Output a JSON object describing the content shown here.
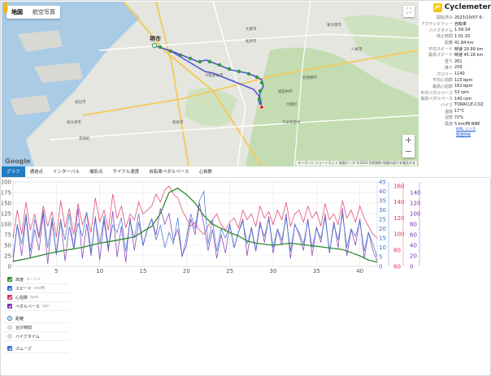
{
  "map": {
    "type_map": "地図",
    "type_satellite": "航空写真",
    "city_label": "堺市",
    "logo": "Google",
    "credits": "キーボード ショートカット  地図データ ©2023  利用規約  地図の誤りを報告する",
    "labels": [
      "大阪狭山市",
      "和泉市",
      "河南町",
      "千早赤阪村",
      "富田林市",
      "羽曳野市",
      "松原市",
      "大東市",
      "八尾市",
      "東大阪市",
      "泉大津市",
      "高石市",
      "忠岡町"
    ]
  },
  "info": {
    "title": "Cyclemeter",
    "rows": [
      {
        "k": "開始済み",
        "v": "2023/10/07 6:"
      },
      {
        "k": "アクティビティー",
        "v": "自転車"
      },
      {
        "k": "バイクタイム",
        "v": "1:59:34"
      },
      {
        "k": "停止時間",
        "v": "1:01:20"
      },
      {
        "k": "距離",
        "v": "41.84 km"
      },
      {
        "k": "平均スピード",
        "v": "時速 20.99 km"
      },
      {
        "k": "最高スピード",
        "v": "時速 45.18 km"
      },
      {
        "k": "登り",
        "v": "261"
      },
      {
        "k": "降り",
        "v": "256"
      },
      {
        "k": "カロリー",
        "v": "1140"
      },
      {
        "k": "平均心拍数",
        "v": "115 bpm"
      },
      {
        "k": "最高心拍数",
        "v": "162 bpm"
      },
      {
        "k": "平均ペダルペース",
        "v": "53 rpm"
      },
      {
        "k": "最高ペダルペース",
        "v": "140 rpm"
      },
      {
        "k": "バイク",
        "v": "TORACLE-COZ"
      },
      {
        "k": "温度",
        "v": "17°C"
      },
      {
        "k": "湿度",
        "v": "72%"
      },
      {
        "k": "風速",
        "v": "5 km/時 NNE"
      }
    ],
    "link1": "KML リンク",
    "link2": "関連情報"
  },
  "tabs": [
    "グラフ",
    "通過点",
    "インターバル",
    "撮影点",
    "サイクル速度",
    "自転車ペダルペース",
    "心拍数"
  ],
  "controls": {
    "series": [
      {
        "label": "高度",
        "unit": "メートル",
        "color": "#2e8b2e"
      },
      {
        "label": "スピード",
        "unit": "km/時",
        "color": "#2f6fd0"
      },
      {
        "label": "心拍数",
        "unit": "bpm",
        "color": "#e03060"
      },
      {
        "label": "ペダルペース",
        "unit": "rpm",
        "color": "#7b2fb0"
      }
    ],
    "xmodes": [
      "距離",
      "合計時間",
      "バイクタイム"
    ],
    "smooth": "スムーズ"
  },
  "chart_data": {
    "type": "line",
    "xlim": [
      0,
      42
    ],
    "x_ticks": [
      5,
      10,
      15,
      20,
      25,
      30,
      35,
      40
    ],
    "left_axis": {
      "ticks": [
        0,
        25,
        50,
        75,
        100,
        125,
        150,
        175,
        200
      ],
      "ylim": [
        0,
        200
      ]
    },
    "axis2": {
      "ticks": [
        0,
        5,
        10,
        15,
        20,
        25,
        30,
        35,
        40,
        45
      ],
      "ylim": [
        0,
        45
      ],
      "color": "#2f6fd0"
    },
    "axis3": {
      "ticks": [
        60,
        80,
        100,
        120,
        140,
        160
      ],
      "ylim": [
        60,
        165
      ],
      "color": "#e03060"
    },
    "axis4": {
      "ticks": [
        0,
        20,
        40,
        60,
        80,
        100,
        120,
        140
      ],
      "ylim": [
        0,
        160
      ],
      "color": "#7b2fb0"
    },
    "series": [
      {
        "name": "高度",
        "axis": "left",
        "color": "#2e8b2e",
        "x": [
          0,
          2,
          4,
          6,
          8,
          10,
          12,
          14,
          16,
          17,
          18,
          19,
          20,
          21,
          22,
          23,
          24,
          25,
          26,
          27,
          28,
          30,
          32,
          34,
          36,
          38,
          40,
          41,
          42
        ],
        "y": [
          12,
          20,
          30,
          38,
          45,
          55,
          62,
          70,
          95,
          125,
          175,
          185,
          170,
          150,
          120,
          100,
          90,
          80,
          72,
          60,
          55,
          50,
          55,
          50,
          45,
          40,
          25,
          15,
          10
        ]
      },
      {
        "name": "スピード",
        "axis": "axis2",
        "color": "#2f6fd0",
        "x": [
          0,
          0.5,
          1,
          1.5,
          2,
          2.5,
          3,
          3.5,
          4,
          4.5,
          5,
          5.5,
          6,
          6.5,
          7,
          7.5,
          8,
          8.5,
          9,
          9.5,
          10,
          10.5,
          11,
          11.5,
          12,
          12.5,
          13,
          13.5,
          14,
          14.5,
          15,
          15.5,
          16,
          16.5,
          17,
          17.5,
          18,
          18.5,
          19,
          19.5,
          20,
          20.5,
          21,
          21.5,
          22,
          22.5,
          23,
          23.5,
          24,
          24.5,
          25,
          25.5,
          26,
          26.5,
          27,
          27.5,
          28,
          28.5,
          29,
          29.5,
          30,
          30.5,
          31,
          31.5,
          32,
          32.5,
          33,
          33.5,
          34,
          34.5,
          35,
          35.5,
          36,
          36.5,
          37,
          37.5,
          38,
          38.5,
          39,
          39.5,
          40,
          40.5,
          41,
          41.5,
          42
        ],
        "y": [
          5,
          22,
          12,
          28,
          8,
          25,
          15,
          30,
          10,
          26,
          6,
          24,
          14,
          28,
          9,
          23,
          16,
          29,
          7,
          25,
          12,
          27,
          10,
          22,
          18,
          26,
          8,
          24,
          15,
          28,
          11,
          20,
          25,
          14,
          22,
          10,
          18,
          12,
          26,
          5,
          15,
          28,
          20,
          35,
          40,
          12,
          25,
          8,
          20,
          15,
          22,
          10,
          18,
          24,
          12,
          20,
          8,
          22,
          16,
          25,
          10,
          20,
          14,
          26,
          8,
          22,
          18,
          12,
          24,
          10,
          20,
          15,
          26,
          8,
          22,
          14,
          28,
          10,
          20,
          16,
          24,
          8,
          18,
          12,
          5
        ]
      },
      {
        "name": "心拍数",
        "axis": "axis3",
        "color": "#e03060",
        "x": [
          0,
          0.5,
          1,
          1.5,
          2,
          2.5,
          3,
          3.5,
          4,
          4.5,
          5,
          5.5,
          6,
          6.5,
          7,
          7.5,
          8,
          8.5,
          9,
          9.5,
          10,
          10.5,
          11,
          11.5,
          12,
          12.5,
          13,
          13.5,
          14,
          14.5,
          15,
          15.5,
          16,
          16.5,
          17,
          17.5,
          18,
          18.5,
          19,
          19.5,
          20,
          20.5,
          21,
          21.5,
          22,
          22.5,
          23,
          23.5,
          24,
          24.5,
          25,
          25.5,
          26,
          26.5,
          27,
          27.5,
          28,
          28.5,
          29,
          29.5,
          30,
          30.5,
          31,
          31.5,
          32,
          32.5,
          33,
          33.5,
          34,
          34.5,
          35,
          35.5,
          36,
          36.5,
          37,
          37.5,
          38,
          38.5,
          39,
          39.5,
          40,
          40.5,
          41,
          41.5,
          42
        ],
        "y": [
          95,
          130,
          100,
          140,
          105,
          125,
          98,
          135,
          110,
          128,
          96,
          142,
          108,
          132,
          100,
          138,
          112,
          126,
          102,
          145,
          115,
          130,
          105,
          150,
          120,
          135,
          108,
          125,
          118,
          140,
          125,
          130,
          135,
          150,
          140,
          155,
          160,
          150,
          145,
          130,
          120,
          110,
          115,
          105,
          100,
          110,
          118,
          125,
          112,
          105,
          115,
          120,
          108,
          130,
          118,
          125,
          110,
          135,
          120,
          128,
          112,
          130,
          118,
          140,
          110,
          125,
          130,
          115,
          135,
          120,
          128,
          110,
          138,
          118,
          125,
          112,
          142,
          120,
          130,
          115,
          135,
          120,
          110,
          100,
          95
        ]
      },
      {
        "name": "ペダルペース",
        "axis": "axis4",
        "color": "#7b2fb0",
        "x": [
          0,
          0.5,
          1,
          1.5,
          2,
          2.5,
          3,
          3.5,
          4,
          4.5,
          5,
          5.5,
          6,
          6.5,
          7,
          7.5,
          8,
          8.5,
          9,
          9.5,
          10,
          10.5,
          11,
          11.5,
          12,
          12.5,
          13,
          13.5,
          14,
          14.5,
          15,
          15.5,
          16,
          16.5,
          17,
          17.5,
          18,
          18.5,
          19,
          19.5,
          20,
          20.5,
          21,
          21.5,
          22,
          22.5,
          23,
          23.5,
          24,
          24.5,
          25,
          25.5,
          26,
          26.5,
          27,
          27.5,
          28,
          28.5,
          29,
          29.5,
          30,
          30.5,
          31,
          31.5,
          32,
          32.5,
          33,
          33.5,
          34,
          34.5,
          35,
          35.5,
          36,
          36.5,
          37,
          37.5,
          38,
          38.5,
          39,
          39.5,
          40,
          40.5,
          41,
          41.5,
          42
        ],
        "y": [
          10,
          80,
          20,
          95,
          15,
          70,
          30,
          100,
          5,
          85,
          25,
          90,
          10,
          75,
          35,
          110,
          15,
          80,
          20,
          95,
          12,
          88,
          28,
          105,
          18,
          76,
          8,
          92,
          30,
          84,
          40,
          70,
          90,
          60,
          110,
          80,
          100,
          50,
          70,
          20,
          40,
          90,
          60,
          120,
          80,
          30,
          70,
          15,
          60,
          25,
          80,
          35,
          65,
          90,
          20,
          75,
          30,
          85,
          45,
          95,
          25,
          70,
          40,
          100,
          15,
          80,
          60,
          30,
          90,
          20,
          75,
          45,
          100,
          25,
          85,
          35,
          110,
          20,
          70,
          40,
          90,
          15,
          65,
          30,
          10
        ]
      }
    ]
  }
}
